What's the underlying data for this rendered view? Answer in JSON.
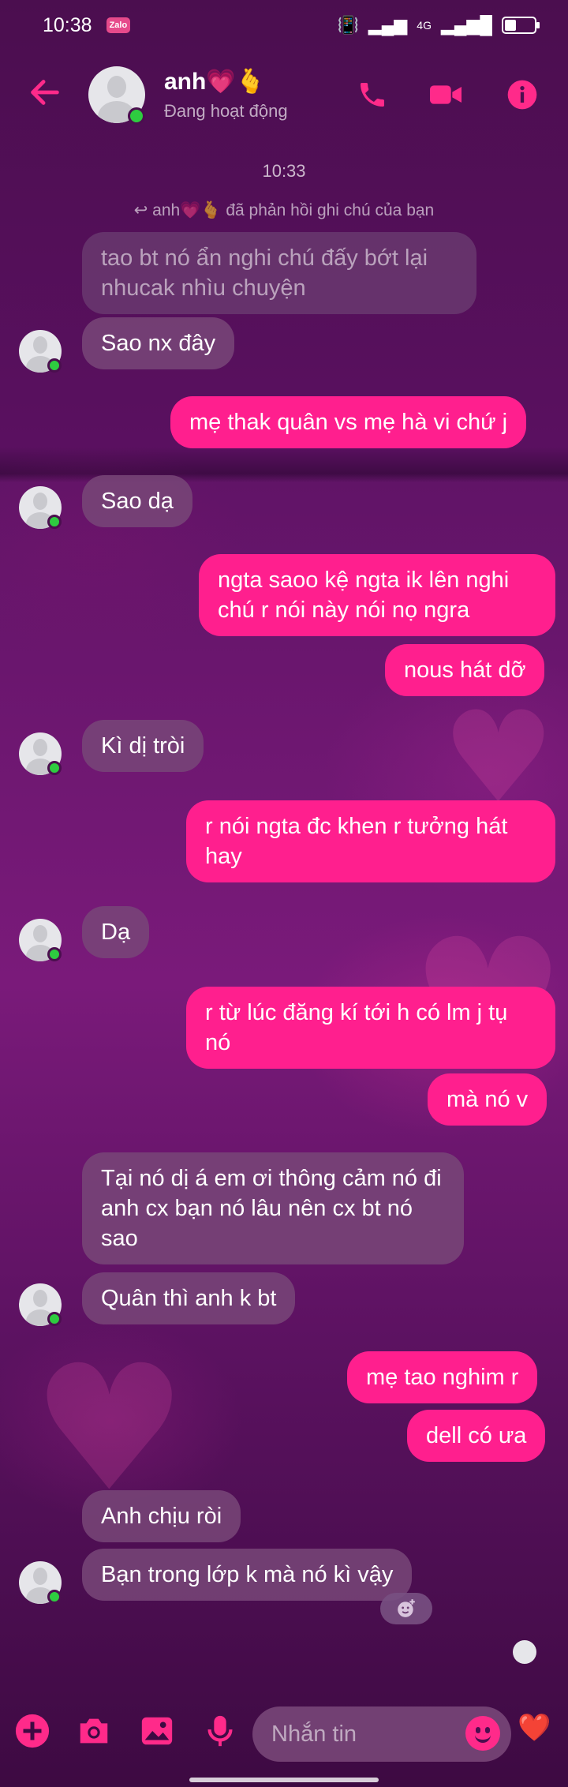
{
  "status_bar": {
    "time": "10:38",
    "app_badge": "Zalo",
    "network": "4G",
    "battery_level": 0.4
  },
  "header": {
    "contact_name": "anh💗🫰",
    "contact_status": "Đang hoạt động",
    "accent_color": "#ff2a8a"
  },
  "chat": {
    "timestamp": "10:33",
    "reply_note": "↩ anh💗🫰 đã phản hồi ghi chú của bạn",
    "messages": [
      {
        "side": "in",
        "text": "tao bt nó ẩn nghi chú đấy bớt lại nhucak nhìu chuyện",
        "faded": true
      },
      {
        "side": "in",
        "text": "Sao nx đây"
      },
      {
        "side": "out",
        "text": "mẹ thak quân vs mẹ hà vi chứ j"
      },
      {
        "side": "in",
        "text": "Sao dạ"
      },
      {
        "side": "out",
        "text": "ngta saoo kệ ngta ik lên nghi chú r nói này nói nọ ngra"
      },
      {
        "side": "out",
        "text": "nous hát dỡ"
      },
      {
        "side": "in",
        "text": "Kì dị tròi"
      },
      {
        "side": "out",
        "text": "r nói ngta đc khen r tưởng hát hay"
      },
      {
        "side": "in",
        "text": "Dạ"
      },
      {
        "side": "out",
        "text": "r từ lúc đăng kí tới h có lm j tụ nó"
      },
      {
        "side": "out",
        "text": "mà nó v"
      },
      {
        "side": "in",
        "text": "Tại nó dị á em ơi thông cảm nó đi anh cx bạn nó lâu nên cx bt nó sao"
      },
      {
        "side": "in",
        "text": "Quân thì anh k bt"
      },
      {
        "side": "out",
        "text": "mẹ tao nghim r"
      },
      {
        "side": "out",
        "text": "dell có ưa"
      },
      {
        "side": "in",
        "text": "Anh chịu ròi"
      },
      {
        "side": "in",
        "text": "Bạn trong lớp k mà nó kì vậy"
      }
    ]
  },
  "composer": {
    "placeholder": "Nhắn tin",
    "like_icon": "❤️"
  }
}
